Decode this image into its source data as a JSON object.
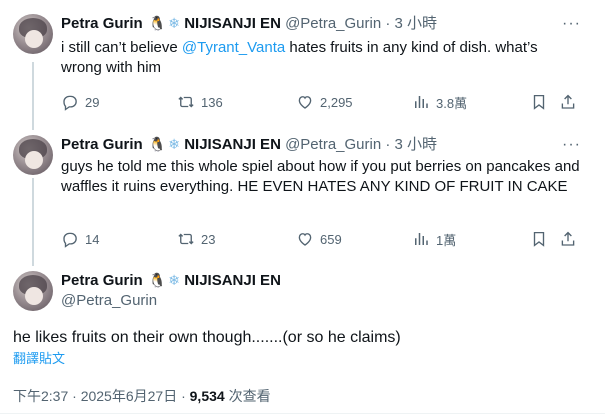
{
  "tweets": [
    {
      "name": "Petra Gurin",
      "emoji_penguin": "🐧",
      "emoji_snow": "❄",
      "affiliation": "NIJISANJI EN",
      "handle": "@Petra_Gurin",
      "time": "3 小時",
      "text_before": "i still can’t believe ",
      "mention": "@Tyrant_Vanta",
      "text_after": " hates fruits in any kind of dish. what’s wrong with him",
      "replies": "29",
      "retweets": "136",
      "likes": "2,295",
      "views": "3.8萬"
    },
    {
      "name": "Petra Gurin",
      "emoji_penguin": "🐧",
      "emoji_snow": "❄",
      "affiliation": "NIJISANJI EN",
      "handle": "@Petra_Gurin",
      "time": "3 小時",
      "text": "guys he told me this whole spiel about how if you put berries on pancakes and waffles it ruins everything. HE EVEN HATES ANY KIND OF FRUIT IN CAKE",
      "replies": "14",
      "retweets": "23",
      "likes": "659",
      "views": "1萬"
    }
  ],
  "main": {
    "name": "Petra Gurin",
    "emoji_penguin": "🐧",
    "emoji_snow": "❄",
    "affiliation": "NIJISANJI EN",
    "handle": "@Petra_Gurin",
    "text": "he likes fruits on their own though.......(or so he claims)",
    "translate": "翻譯貼文",
    "timestamp": "下午2:37 · 2025年6月27日 · ",
    "views_count": "9,534",
    "views_label": " 次查看"
  },
  "separator": " · ",
  "more_glyph": "···",
  "icons": [
    "more-icon",
    "reply-icon",
    "retweet-icon",
    "like-icon",
    "views-icon",
    "bookmark-icon",
    "share-icon"
  ]
}
